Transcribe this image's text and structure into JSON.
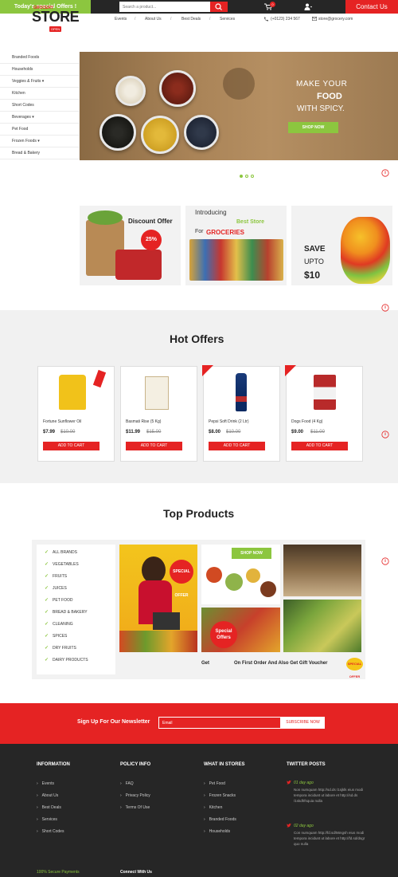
{
  "topbar": {
    "offers": "Today's special Offers !",
    "search_placeholder": "Search a product...",
    "cart_count": "0",
    "contact": "Contact Us"
  },
  "header": {
    "logo_small": "GROCERY",
    "logo_main": "STORE",
    "logo_badge": "OPEN",
    "nav": [
      "Events",
      "About Us",
      "Best Deals",
      "Services"
    ],
    "phone": "(+0123) 234 567",
    "email": "store@grocery.com"
  },
  "sidebar": {
    "items": [
      "Branded Foods",
      "Households",
      "Veggies & Fruits",
      "Kitchen",
      "Short Codes",
      "Beverages",
      "Pet Food",
      "Frozen Foods",
      "Bread & Bakery"
    ],
    "has_dropdown": [
      false,
      false,
      true,
      false,
      false,
      true,
      false,
      true,
      false
    ]
  },
  "hero": {
    "line1": "MAKE YOUR",
    "line2": "FOOD",
    "line3": "WITH SPICY.",
    "button": "SHOP NOW"
  },
  "promos": {
    "discount_title": "Discount Offer",
    "discount_badge": "25%",
    "intro": "Introducing",
    "best_store": "Best Store",
    "for": "For",
    "groceries": "GROCERIES",
    "save": "SAVE",
    "upto": "UPTO",
    "amount": "$10"
  },
  "hot_offers": {
    "title": "Hot Offers",
    "products": [
      {
        "name": "Fortune Sunflower Oil",
        "price": "$7.99",
        "old_price": "$10.00",
        "button": "ADD TO CART"
      },
      {
        "name": "Basmati Rise (5 Kg)",
        "price": "$11.99",
        "old_price": "$15.00",
        "button": "ADD TO CART"
      },
      {
        "name": "Pepsi Soft Drink (2 Ltr)",
        "price": "$8.00",
        "old_price": "$10.00",
        "button": "ADD TO CART"
      },
      {
        "name": "Dogs Food (4 Kg)",
        "price": "$9.00",
        "old_price": "$11.00",
        "button": "ADD TO CART"
      }
    ]
  },
  "top_products": {
    "title": "Top Products",
    "categories": [
      "ALL BRANDS",
      "VEGETABLES",
      "FRUITS",
      "JUICES",
      "PET FOOD",
      "BREAD & BAKERY",
      "CLEANING",
      "SPICES",
      "DRY FRUITS",
      "DAIRY PRODUCTS"
    ],
    "special_offer": "Special Offers",
    "shop_now": "SHOP NOW",
    "get": "Get",
    "voucher": "On First Order And Also Get Gift Voucher",
    "voucher_badge": "SPECIAL OFFER"
  },
  "newsletter": {
    "label": "Sign Up For Our Newsletter",
    "placeholder": "Email",
    "button": "SUBSCRIBE NOW"
  },
  "footer": {
    "information": {
      "title": "INFORMATION",
      "links": [
        "Events",
        "About Us",
        "Best Deals",
        "Services",
        "Short Codes"
      ]
    },
    "policy": {
      "title": "POLICY INFO",
      "links": [
        "FAQ",
        "Privacy Policy",
        "Terms Of Use"
      ]
    },
    "stores": {
      "title": "WHAT IN STORES",
      "links": [
        "Pet Food",
        "Frozen Snacks",
        "Kitchen",
        "Branded Foods",
        "Households"
      ]
    },
    "twitter": {
      "title": "TWITTER POSTS",
      "posts": [
        {
          "date": "01 day ago",
          "text": "Non numquam http://sd.ds /1sjklk eius modi tempora incidunt ut labore et http://sd.ds /1skdhfsquia nulla"
        },
        {
          "date": "02 day ago",
          "text": "Con numquam http://fd.sd/56ngsh eius modi tempora incidunt ut labore et http://fd.sd/dsgr quo nulla"
        }
      ]
    },
    "secure": "100% Secure Payments",
    "connect": "Connect With Us"
  },
  "colors": {
    "red": "#e52323",
    "green": "#8cc63f",
    "dark": "#262626"
  }
}
